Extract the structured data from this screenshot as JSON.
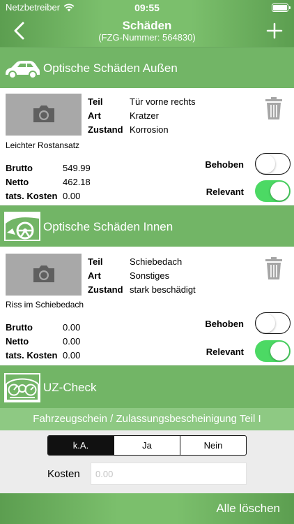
{
  "status_bar": {
    "carrier": "Netzbetreiber",
    "time": "09:55"
  },
  "nav": {
    "title": "Schäden",
    "subtitle": "(FZG-Nummer: 564830)"
  },
  "sections": {
    "outside": {
      "title": "Optische Schäden Außen"
    },
    "inside": {
      "title": "Optische Schäden Innen"
    },
    "uz": {
      "title": "UZ-Check"
    }
  },
  "damages": [
    {
      "teil_label": "Teil",
      "teil": "Tür vorne rechts",
      "art_label": "Art",
      "art": "Kratzer",
      "zustand_label": "Zustand",
      "zustand": "Korrosion",
      "description": "Leichter Rostansatz",
      "brutto_label": "Brutto",
      "brutto": "549.99",
      "netto_label": "Netto",
      "netto": "462.18",
      "kosten_label": "tats. Kosten",
      "kosten": "0.00",
      "behoben_label": "Behoben",
      "behoben": false,
      "relevant_label": "Relevant",
      "relevant": true
    },
    {
      "teil_label": "Teil",
      "teil": "Schiebedach",
      "art_label": "Art",
      "art": "Sonstiges",
      "zustand_label": "Zustand",
      "zustand": "stark beschädigt",
      "description": "Riss im Schiebedach",
      "brutto_label": "Brutto",
      "brutto": "0.00",
      "netto_label": "Netto",
      "netto": "0.00",
      "kosten_label": "tats. Kosten",
      "kosten": "0.00",
      "behoben_label": "Behoben",
      "behoben": false,
      "relevant_label": "Relevant",
      "relevant": true
    }
  ],
  "uz_check": {
    "item_title": "Fahrzeugschein / Zulassungsbescheinigung Teil I",
    "options": [
      "k.A.",
      "Ja",
      "Nein"
    ],
    "selected": "k.A.",
    "kosten_label": "Kosten",
    "kosten_placeholder": "0.00"
  },
  "footer": {
    "delete_all": "Alle löschen"
  },
  "colors": {
    "header_green": "#72b566",
    "toggle_on": "#4cd964",
    "subheader_green": "#8ec983"
  },
  "icons": [
    "wifi-icon",
    "back-chevron-icon",
    "plus-icon",
    "car-exterior-icon",
    "car-interior-icon",
    "dashboard-icon",
    "camera-icon",
    "trash-icon"
  ]
}
